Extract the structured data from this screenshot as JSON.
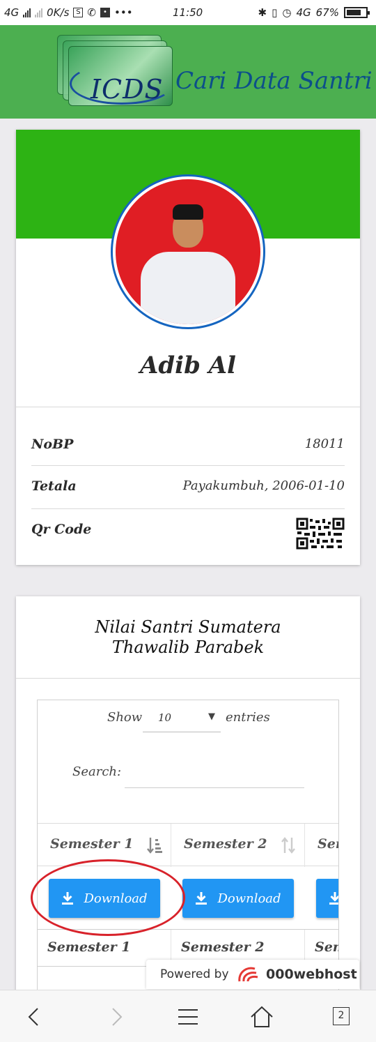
{
  "status_bar": {
    "network_left": "4G",
    "speed": "0K/s",
    "time": "11:50",
    "network_right": "4G",
    "battery": "67%"
  },
  "header": {
    "logo_text": "ICDS",
    "brand_text": "Cari Data Santri"
  },
  "profile": {
    "name": "Adib Al",
    "rows": [
      {
        "label": "NoBP",
        "value": "18011"
      },
      {
        "label": "Tetala",
        "value": "Payakumbuh, 2006-01-10"
      },
      {
        "label": "Qr Code",
        "value": ""
      }
    ]
  },
  "grades": {
    "title": "Nilai Santri Sumatera Thawalib Parabek",
    "show_label": "Show",
    "page_length": "10",
    "entries_label": "entries",
    "search_label": "Search:",
    "search_value": "",
    "columns": [
      "Semester 1",
      "Semester 2",
      "Sem"
    ],
    "download_label": "Download",
    "footer": [
      "Semester 1",
      "Semester 2",
      "Sem"
    ]
  },
  "powered_by": {
    "label": "Powered by",
    "brand": "000webhost"
  },
  "bottom_nav": {
    "tabs_count": "2"
  },
  "colors": {
    "header_green": "#4caf50",
    "banner_green": "#2db314",
    "button_blue": "#2196f3",
    "annotation_red": "#d8222a"
  }
}
